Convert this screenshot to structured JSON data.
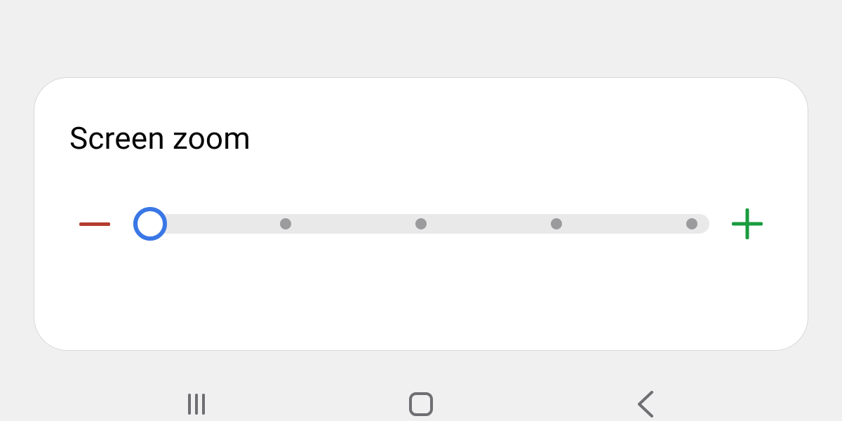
{
  "card": {
    "title": "Screen zoom"
  },
  "slider": {
    "steps": 5,
    "selected_index": 0,
    "minus_color": "#b43c2f",
    "plus_color": "#1a9c3f",
    "thumb_color": "#3a77e6"
  },
  "icons": {
    "minus": "minus-icon",
    "plus": "plus-icon",
    "nav_recent": "recent-apps-icon",
    "nav_home": "home-icon",
    "nav_back": "back-icon"
  }
}
